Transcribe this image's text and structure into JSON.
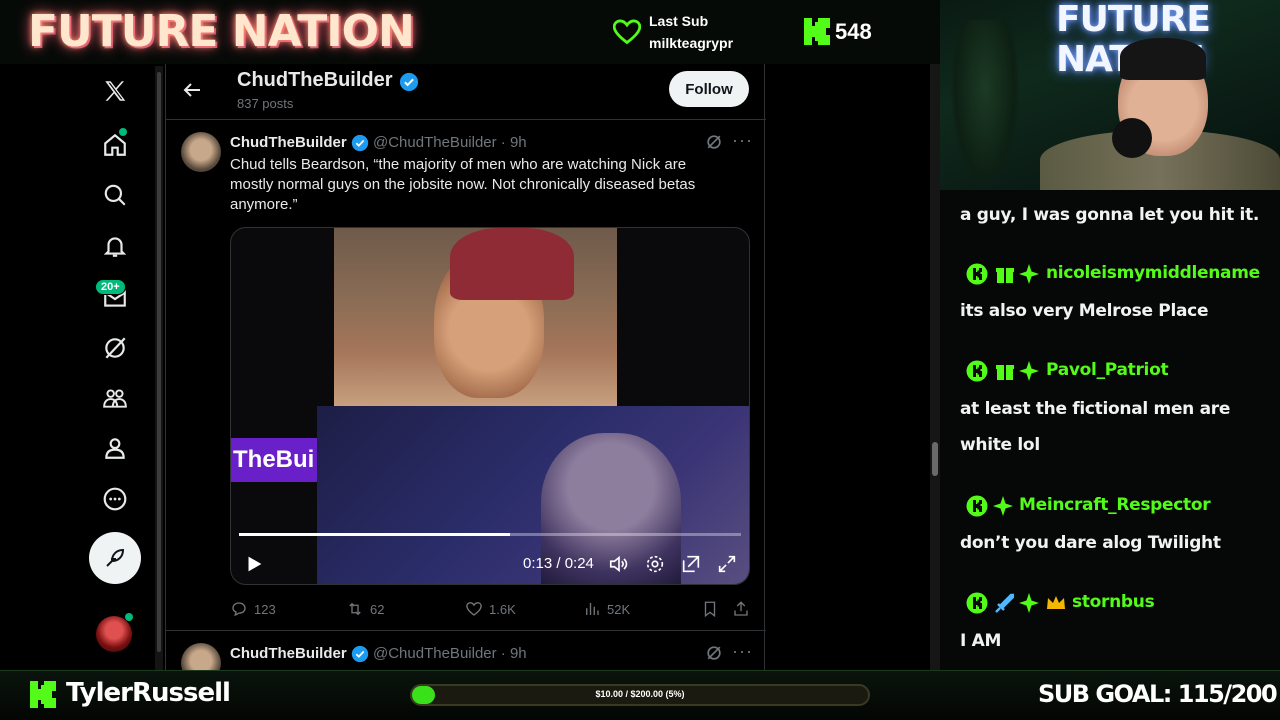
{
  "overlay": {
    "brand": "FUTURE NATION",
    "last_sub_title": "Last Sub",
    "last_sub_name": "milkteagrypr",
    "follower_count": "548",
    "accent": "#53fc18"
  },
  "profile": {
    "name": "ChudTheBuilder",
    "post_count": "837 posts",
    "follow_label": "Follow"
  },
  "nav": {
    "messages_badge": "20+"
  },
  "tweet1": {
    "name": "ChudTheBuilder",
    "handle": "@ChudTheBuilder · 9h",
    "text": "Chud tells Beardson, “the majority of men who are watching Nick are mostly normal guys on the jobsite now. Not chronically diseased betas anymore.”",
    "video_label": "TheBui",
    "video_time": "0:13 / 0:24",
    "video_progress": 0.54,
    "replies": "123",
    "reposts": "62",
    "likes": "1.6K",
    "views": "52K"
  },
  "tweet2": {
    "name": "ChudTheBuilder",
    "handle": "@ChudTheBuilder · 9h"
  },
  "chat": {
    "messages": [
      {
        "text": "a guy, I was gonna let you hit it."
      },
      {
        "user": "nicoleismymiddlename",
        "text": "its also very Melrose Place"
      },
      {
        "user": "Pavol_Patriot",
        "text": "at least the fictional men are",
        "text2": "white lol"
      },
      {
        "user": "Meincraft_Respector",
        "text": "don’t you dare alog Twilight"
      },
      {
        "user": "stornbus",
        "text": "I AM"
      }
    ]
  },
  "footer": {
    "streamer": "TylerRussell",
    "goal_text": "$10.00 / $200.00 (5%)",
    "goal_progress": 0.05,
    "sub_goal": "SUB GOAL: 115/200"
  }
}
